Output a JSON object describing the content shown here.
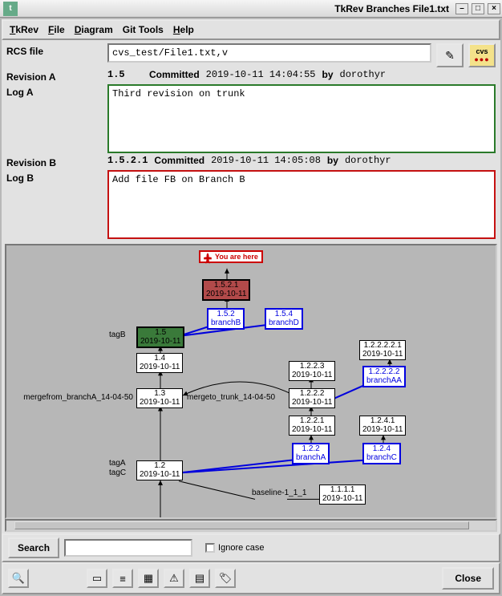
{
  "window": {
    "title": "TkRev Branches File1.txt"
  },
  "menu": {
    "tkrev": "TkRev",
    "file": "File",
    "diagram": "Diagram",
    "gittools": "Git Tools",
    "help": "Help"
  },
  "rcs": {
    "label": "RCS file",
    "value": "cvs_test/File1.txt,v"
  },
  "revA": {
    "label": "Revision A",
    "rev": "1.5",
    "committed_label": "Committed",
    "committed_at": "2019-10-11 14:04:55",
    "by_label": "by",
    "by": "dorothyr",
    "log_label": "Log A",
    "log": "Third revision on trunk"
  },
  "revB": {
    "label": "Revision B",
    "rev": "1.5.2.1",
    "committed_label": "Committed",
    "committed_at": "2019-10-11 14:05:08",
    "by_label": "by",
    "by": "dorothyr",
    "log_label": "Log B",
    "log": "Add file FB on Branch B"
  },
  "youhere": "You are\nhere",
  "nodes": {
    "n1521": {
      "rev": "1.5.2.1",
      "date": "2019-10-11"
    },
    "n152": {
      "rev": "1.5.2",
      "name": "branchB"
    },
    "n154": {
      "rev": "1.5.4",
      "name": "branchD"
    },
    "n15": {
      "rev": "1.5",
      "date": "2019-10-11"
    },
    "n14": {
      "rev": "1.4",
      "date": "2019-10-11"
    },
    "n13": {
      "rev": "1.3",
      "date": "2019-10-11"
    },
    "n12": {
      "rev": "1.2",
      "date": "2019-10-11"
    },
    "n1223": {
      "rev": "1.2.2.3",
      "date": "2019-10-11"
    },
    "n1222": {
      "rev": "1.2.2.2",
      "date": "2019-10-11"
    },
    "n1221": {
      "rev": "1.2.2.1",
      "date": "2019-10-11"
    },
    "n122": {
      "rev": "1.2.2",
      "name": "branchA"
    },
    "n124": {
      "rev": "1.2.4",
      "name": "branchC"
    },
    "n1241": {
      "rev": "1.2.4.1",
      "date": "2019-10-11"
    },
    "n12222": {
      "rev": "1.2.2.2.2",
      "name": "branchAA"
    },
    "n122221": {
      "rev": "1.2.2.2.2.1",
      "date": "2019-10-11"
    },
    "n1111": {
      "rev": "1.1.1.1",
      "date": "2019-10-11"
    }
  },
  "tags": {
    "tagB": "tagB",
    "mergefrom": "mergefrom_branchA_14-04-50",
    "mergeto": "mergeto_trunk_14-04-50",
    "tagA": "tagA",
    "tagC": "tagC",
    "baseline": "baseline-1_1_1"
  },
  "search": {
    "label": "Search",
    "ignore_case": "Ignore case"
  },
  "close": "Close",
  "icons": {
    "edit": "✎",
    "cvs": "cvs",
    "globe": "🔍",
    "page": "▭",
    "lines": "≡",
    "palette": "▦",
    "warn": "⚠",
    "boxes": "▤",
    "tag": "🏷"
  }
}
